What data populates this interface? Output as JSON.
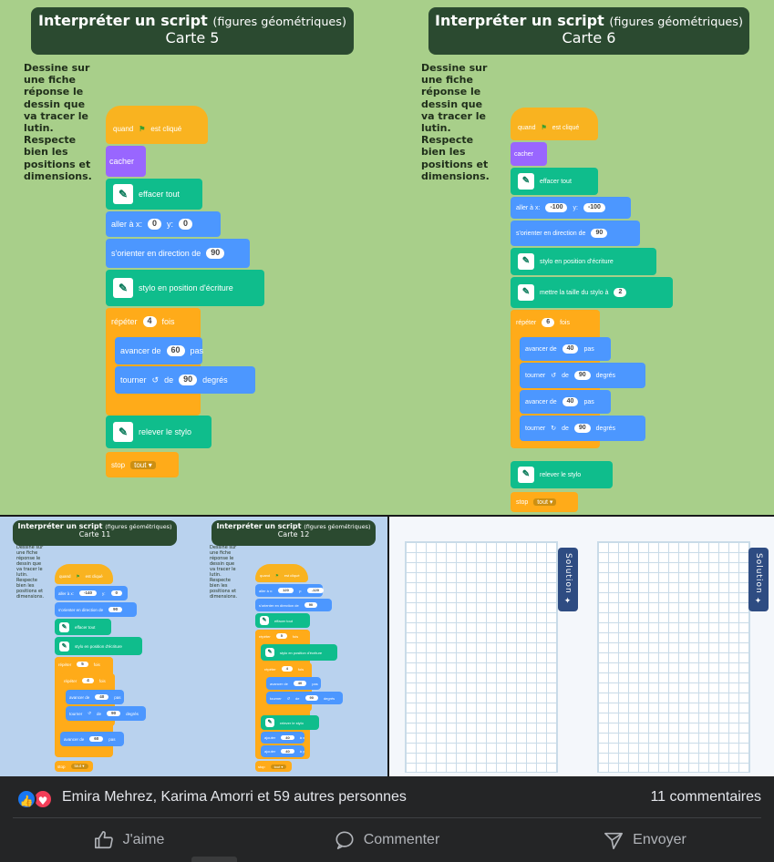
{
  "card5": {
    "title": "Interpréter un script",
    "subtitle": "(figures géométriques)",
    "card": "Carte 5",
    "instr1": "Dessine sur une fiche réponse le dessin que va tracer le lutin.",
    "instr2": "Respecte bien les positions et dimensions.",
    "blocks": {
      "when_flag": "quand",
      "when_flag_end": "est cliqué",
      "hide": "cacher",
      "clear": "effacer tout",
      "goto": "aller à x:",
      "goto_x": "0",
      "goto_y_label": "y:",
      "goto_y": "0",
      "point": "s'orienter en direction de",
      "point_val": "90",
      "pendown": "stylo en position d'écriture",
      "repeat": "répéter",
      "repeat_val": "4",
      "repeat_end": "fois",
      "move": "avancer de",
      "move_val": "60",
      "move_end": "pas",
      "turn": "tourner",
      "turn_de": "de",
      "turn_val": "90",
      "turn_end": "degrés",
      "penup": "relever le stylo",
      "stop": "stop",
      "stop_val": "tout"
    }
  },
  "card6": {
    "title": "Interpréter un script",
    "subtitle": "(figures géométriques)",
    "card": "Carte 6",
    "instr1": "Dessine sur une fiche réponse le dessin que va tracer le lutin.",
    "instr2": "Respecte bien les positions et dimensions.",
    "blocks": {
      "when_flag": "quand",
      "when_flag_end": "est cliqué",
      "hide": "cacher",
      "clear": "effacer tout",
      "goto": "aller à x:",
      "goto_x": "-100",
      "goto_y_label": "y:",
      "goto_y": "-100",
      "point": "s'orienter en direction de",
      "point_val": "90",
      "pendown": "stylo en position d'écriture",
      "pensize": "mettre la taille du stylo à",
      "pensize_val": "2",
      "repeat": "répéter",
      "repeat_val": "6",
      "repeat_end": "fois",
      "move1": "avancer de",
      "move1_val": "40",
      "move1_end": "pas",
      "turn1": "tourner",
      "turn1_de": "de",
      "turn1_val": "90",
      "turn1_end": "degrés",
      "move2": "avancer de",
      "move2_val": "40",
      "move2_end": "pas",
      "turn2": "tourner",
      "turn2_de": "de",
      "turn2_val": "90",
      "turn2_end": "degrés",
      "penup": "relever le stylo",
      "stop": "stop",
      "stop_val": "tout"
    }
  },
  "card11": {
    "title": "Interpréter un script",
    "subtitle": "(figures géométriques)",
    "card": "Carte 11",
    "instr1": "Dessine sur une fiche réponse le dessin que va tracer le lutin.",
    "instr2": "Respecte bien les positions et dimensions.",
    "blocks": {
      "when_flag": "quand",
      "when_flag_end": "est cliqué",
      "goto": "aller à x:",
      "goto_x": "-140",
      "goto_y_label": "y:",
      "goto_y": "0",
      "point": "s'orienter en direction de",
      "point_val": "90",
      "clear": "effacer tout",
      "pendown": "stylo en position d'écriture",
      "repeat_outer": "répéter",
      "repeat_outer_val": "5",
      "repeat_outer_end": "fois",
      "repeat_inner": "répéter",
      "repeat_inner_val": "4",
      "repeat_inner_end": "fois",
      "move": "avancer de",
      "move_val": "40",
      "move_end": "pas",
      "turn": "tourner",
      "turn_de": "de",
      "turn_val": "90",
      "turn_end": "degrés",
      "move_after": "avancer de",
      "move_after_val": "60",
      "move_after_end": "pas",
      "stop": "stop",
      "stop_val": "tout"
    }
  },
  "card12": {
    "title": "Interpréter un script",
    "subtitle": "(figures géométriques)",
    "card": "Carte 12",
    "instr1": "Dessine sur une fiche réponse le dessin que va tracer le lutin.",
    "instr2": "Respecte bien les positions et dimensions.",
    "blocks": {
      "when_flag": "quand",
      "when_flag_end": "est cliqué",
      "goto": "aller à x:",
      "goto_x": "120",
      "goto_y_label": "y:",
      "goto_y": "-120",
      "point": "s'orienter en direction de",
      "point_val": "90",
      "clear": "effacer tout",
      "repeat_outer": "répéter",
      "repeat_outer_val": "5",
      "repeat_outer_end": "fois",
      "pendown": "stylo en position d'écriture",
      "repeat_inner": "répéter",
      "repeat_inner_val": "4",
      "repeat_inner_end": "fois",
      "move": "avancer de",
      "move_val": "40",
      "move_end": "pas",
      "turn": "tourner",
      "turn_de": "de",
      "turn_val": "90",
      "turn_end": "degrés",
      "penup": "relever le stylo",
      "addx": "ajouter",
      "addx_val": "40",
      "addx_end": "à x",
      "addy": "ajouter",
      "addy_val": "40",
      "addy_end": "à y",
      "stop": "stop",
      "stop_val": "tout"
    }
  },
  "solution": {
    "label": "Solution"
  },
  "footer": {
    "reactors": "Emira Mehrez, Karima Amorri et 59 autres personnes",
    "comments": "11 commentaires",
    "like": "J'aime",
    "comment": "Commenter",
    "send": "Envoyer"
  },
  "icons": {
    "like": "like-icon",
    "love": "love-icon",
    "thumb": "thumbs-up-icon",
    "comment": "comment-bubble-icon",
    "send": "send-icon"
  },
  "colors": {
    "facebook_blue": "#1877f2",
    "love_red": "#f33e58",
    "scratch_events": "#f9b320",
    "scratch_motion": "#4c97ff",
    "scratch_pen": "#0fbd8c",
    "scratch_looks": "#9966ff",
    "scratch_control": "#ffab19"
  }
}
